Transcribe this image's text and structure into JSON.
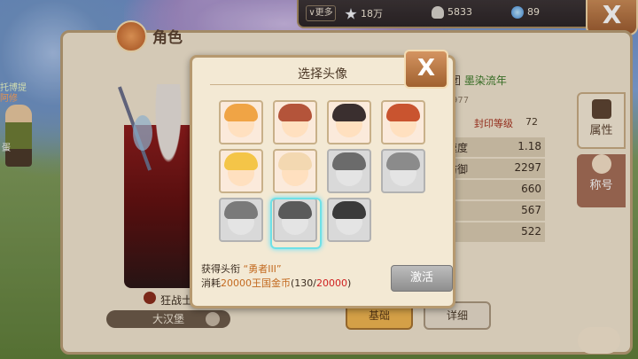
{
  "topbar": {
    "more_label": "更多",
    "stars": "18万",
    "shells": "5833",
    "gems": "89",
    "close_symbol": "X"
  },
  "char_panel": {
    "title": "角色",
    "npc_name_line1": "托博提",
    "npc_name_line2": "阿修",
    "npc_side_text": "蛋",
    "class_label": "狂战士",
    "city_name": "大汉堡",
    "guild_label": "团",
    "guild_name": "墨染流年",
    "partial_number": "977",
    "seal_label": "封印等级",
    "seal_value": "72",
    "stats": [
      {
        "label": "速度",
        "value": "1.18"
      },
      {
        "label": "防御",
        "value": "2297"
      },
      {
        "label": "",
        "value": "660"
      },
      {
        "label": "",
        "value": "567"
      },
      {
        "label": "",
        "value": "522"
      }
    ],
    "tabs": [
      {
        "label": "属性",
        "active": true
      },
      {
        "label": "称号",
        "active": false
      }
    ],
    "basic_button": "基础",
    "detail_button": "详细"
  },
  "modal": {
    "title": "选择头像",
    "close_symbol": "X",
    "avatars": [
      {
        "name": "fox-avatar",
        "gray": false,
        "color": "#f0a445"
      },
      {
        "name": "girl-avatar",
        "gray": false,
        "color": "#b4543a"
      },
      {
        "name": "dark-hair-avatar",
        "gray": false,
        "color": "#3a2f2f"
      },
      {
        "name": "red-hair-avatar",
        "gray": false,
        "color": "#c9542f"
      },
      {
        "name": "blonde-avatar",
        "gray": false,
        "color": "#f4c548"
      },
      {
        "name": "sheep-avatar",
        "gray": false,
        "color": "#f3d8b1"
      },
      {
        "name": "goggles-avatar",
        "gray": true,
        "color": "#6b6b6b"
      },
      {
        "name": "rabbit-avatar",
        "gray": true,
        "color": "#8b8b8b"
      },
      {
        "name": "blond-boy-avatar",
        "gray": true,
        "color": "#7a7a7a"
      },
      {
        "name": "spiky-hair-avatar",
        "gray": true,
        "color": "#5a5a5a"
      },
      {
        "name": "bear-avatar",
        "gray": true,
        "color": "#3a3a3a"
      }
    ],
    "title_line_prefix": "获得头衔",
    "title_line_value": "“勇者III”",
    "cost_prefix": "消耗",
    "cost_amount": "20000",
    "cost_currency": "王国金币",
    "cost_progress_open": "(130/",
    "cost_progress_need": "20000",
    "cost_progress_close": ")",
    "activate_button": "激活"
  }
}
